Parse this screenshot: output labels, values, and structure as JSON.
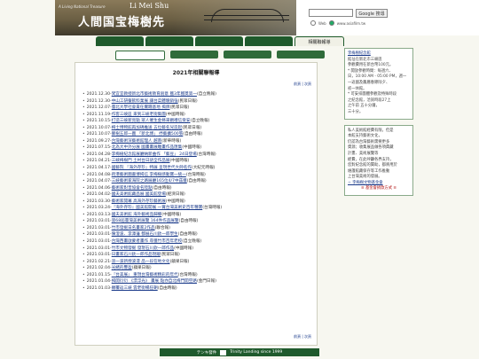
{
  "header": {
    "subtitle_en": "A Living National Treasure",
    "logo_en": "Li Mei Shu",
    "logo_cn": "人間国宝梅樹先",
    "search_button": "Google 搜尋",
    "search_option_web": "Web",
    "search_option_site": "www.asiafilm.tw"
  },
  "nav": {
    "tabs": [
      "",
      "",
      "",
      "",
      "相關聯報導"
    ],
    "active_index": 4
  },
  "subnav": {
    "tabs": [
      "",
      "",
      "",
      ""
    ],
    "active_index": 0
  },
  "main": {
    "title": "2021年相關聯報導",
    "nav_links": [
      "前頁",
      "次頁"
    ],
    "items": [
      {
        "date": "2021.12.30-",
        "title": "梵宜宜教授新北市藝術教育創意 獲3年獲獎第一",
        "source": "(自立晚報)"
      },
      {
        "date": "2021.12.30-",
        "title": "中山工研餐飲料業展 讓台菜體驗銷強",
        "source": "(民眾日報)"
      },
      {
        "date": "2021.12.07-",
        "title": "臺北大學社會責任實踐基地 揭牌",
        "source": "(民眾日報)"
      },
      {
        "date": "2021.11.19-",
        "title": "作客三峽區 來到三峽老街集團",
        "source": "(中國時報)"
      },
      {
        "date": "2021.10.15-",
        "title": "打造三峽新亮點 眾人催生金條來觀禮信受安",
        "source": "(自立晚報)"
      },
      {
        "date": "2021.10.07-",
        "title": "梅士博物館再加碼推送 五位藝名兒造起",
        "source": "(民眾日報)"
      },
      {
        "date": "2021.10.07-",
        "title": "鄭樹五郎一圖 「新北博」 抒藝擴500張",
        "source": "(自由時報)"
      },
      {
        "date": "2021.09.27-",
        "title": "台灣藝術深藝術館理人 越南",
        "source": "(新華時報)"
      },
      {
        "date": "2021.07.15-",
        "title": "北為大中外分展 國畫畫展雕畫作品匯集",
        "source": "(中國時報)"
      },
      {
        "date": "2021.04.28-",
        "title": "李梅樹紀念館展廳納新曲作 「藝豆」 24日登場",
        "source": "(台灣時報)"
      },
      {
        "date": "2021.04.21-",
        "title": "三峽梅樹門 土村台日語全作品展",
        "source": "(中國時報)"
      },
      {
        "date": "2021.04.17-",
        "title": "國藝院 『海外存珍』特展 呈現世代大師名作",
        "source": "(大紀元時報)"
      },
      {
        "date": "2021.04.08-",
        "title": "跨港藝術圖書博揭信 李梅樹感動寶一統一",
        "source": "(台灣時報)"
      },
      {
        "date": "2021.04.07-",
        "title": "三峽藝術家海院之路展廳165位4/7中茲獲",
        "source": "(自由時報)"
      },
      {
        "date": "2021.04.06-",
        "title": "藝術家對普協會名陸點",
        "source": "(自由時報)"
      },
      {
        "date": "2021.04.02-",
        "title": "國夫美術館藏品展 國美館登場",
        "source": "(經濟日報)"
      },
      {
        "date": "2021.03.30-",
        "title": "藝術家開幕 高海外存珍藝術展",
        "source": "(中國時報)"
      },
      {
        "date": "2021.03.24-",
        "title": "『海外存珍』國美館開展 一賞台灣美術史百年種寶",
        "source": "(台灣時報)"
      },
      {
        "date": "2021.03.13-",
        "title": "國夫美術館 海外藝術品歸鄉",
        "source": "(中國時報)"
      },
      {
        "date": "2021.03.01-",
        "title": "第68屆臺灣美術展覽 164件作品展覽",
        "source": "(自由時報)"
      },
      {
        "date": "2021.03.01-",
        "title": "竹市發掘日名畫家2作品",
        "source": "(聯合報)"
      },
      {
        "date": "2021.03.01-",
        "title": "陳澄波、李澤藩 都展石川欽一郎學生",
        "source": "(自由時報)"
      },
      {
        "date": "2021.03.01-",
        "title": "台灣西畫啟蒙者畫作 尋獲竹市百年老校",
        "source": "(自立晚報)"
      },
      {
        "date": "2021.03.01-",
        "title": "竹市文物發掘 發現石川欽一郎作品",
        "source": "(中國時報)"
      },
      {
        "date": "2021.03.01-",
        "title": "日畫家石川欽一郎作品現蹤",
        "source": "(民眾日報)"
      },
      {
        "date": "2021.02.21-",
        "title": "滾一波新煙波漫 品一段在地文化",
        "source": "(蘋果日報)"
      },
      {
        "date": "2021.02.04-",
        "title": "光緒的豐盈",
        "source": "(蘋果日報)"
      },
      {
        "date": "2021.01.15-",
        "title": "『台美展』 重現台灣藝術精彩的年代",
        "source": "(台灣時報)"
      },
      {
        "date": "2021.01.04-",
        "title": "揭開衍衍 《漂浮光》 畫展 點亦自北梅門開空路",
        "source": "(金門日報)"
      },
      {
        "date": "2021.01.03-",
        "title": "顛覆返三峽 雲老街暢狂朝",
        "source": "(自由時報)"
      }
    ]
  },
  "sidebar": {
    "box1": {
      "link": "李梅樹紀念館",
      "lines": [
        "館址在新北市三峽區",
        "參觀費用在新台幣100元。",
        "* 開放參觀時間：每週六、",
        "日，10:00 AM - 05:00 PM，週一",
        "一返國及農曆春節除夕、",
        "初一休館。",
        "* 可安排團體參觀及特殊時段",
        "之紀念館，洽詢時段27上",
        "之午前 五十分鐘，",
        "三十分。"
      ]
    },
    "box2": {
      "lines": [
        "私人美術館經費有限，但是",
        "本館支持藝術文化，",
        "仍認為台灣藝術需要更多",
        "資源；收集展品做各項典藏",
        "計畫、美術展覽等",
        "經費，在此呼籲各界支持，",
        "您對紀念館的贊助，都將用於",
        "維護館藏保存等工作推動",
        "上台灣美術的發展。"
      ],
      "link": "☆ 李梅樹文物基金會",
      "cta": "≡ 基金會捐款方式 ≡"
    }
  },
  "footer": {
    "brand": "テンキ發件",
    "text": "Trinity Landing since 1999"
  },
  "colors": {
    "nav_green": "#1f5a2c",
    "link_blue": "#1a3a8a",
    "accent_red": "#b01010"
  }
}
